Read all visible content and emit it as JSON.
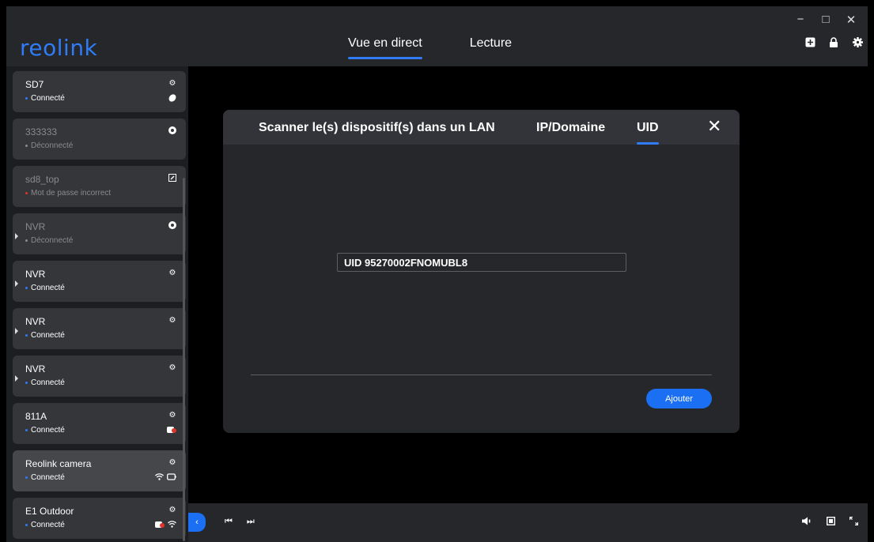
{
  "window": {
    "controls": [
      "−",
      "□",
      "✕"
    ]
  },
  "header": {
    "logo": "reolink",
    "tabs": [
      {
        "label": "Vue en direct",
        "active": true
      },
      {
        "label": "Lecture",
        "active": false
      }
    ],
    "actions": [
      "add-device-icon",
      "lock-icon",
      "gear-icon"
    ]
  },
  "sidebar": {
    "devices": [
      {
        "name": "SD7",
        "status": "Connecté",
        "state": "connected",
        "icon": "gear-icon",
        "extra": "battery-icon"
      },
      {
        "name": "333333",
        "status": "Déconnecté",
        "state": "disconnected",
        "icon": "refresh-icon"
      },
      {
        "name": "sd8_top",
        "status": "Mot de passe incorrect",
        "state": "error",
        "icon": "edit-icon"
      },
      {
        "name": "NVR",
        "status": "Déconnecté",
        "state": "disconnected",
        "icon": "refresh-icon",
        "expandable": true
      },
      {
        "name": "NVR",
        "status": "Connecté",
        "state": "connected",
        "icon": "gear-icon",
        "expandable": true
      },
      {
        "name": "NVR",
        "status": "Connecté",
        "state": "connected",
        "icon": "gear-icon",
        "expandable": true
      },
      {
        "name": "NVR",
        "status": "Connecté",
        "state": "connected",
        "icon": "gear-icon",
        "expandable": true
      },
      {
        "name": "811A",
        "status": "Connecté",
        "state": "connected",
        "icon": "gear-icon",
        "extra": "battery-red-icon"
      },
      {
        "name": "Reolink camera",
        "status": "Connecté",
        "state": "connected",
        "icon": "gear-icon",
        "extra": "wifi-battery-icon",
        "selected": true
      },
      {
        "name": "E1 Outdoor",
        "status": "Connecté",
        "state": "connected",
        "icon": "gear-icon",
        "extra": "record-wifi-icon"
      }
    ]
  },
  "modal": {
    "tabs": [
      {
        "label": "Scanner le(s) dispositif(s) dans un LAN",
        "active": false
      },
      {
        "label": "IP/Domaine",
        "active": false
      },
      {
        "label": "UID",
        "active": true
      }
    ],
    "close": "✕",
    "uid_value": "UID  95270002FNOMUBL8",
    "add_button": "Ajouter"
  },
  "bottom": {
    "collapse": "‹",
    "prev": "⏮",
    "next": "⏭",
    "view_controls": [
      "volume-icon",
      "single-view-icon",
      "fullscreen-icon"
    ]
  },
  "colors": {
    "accent": "#1b6ff2",
    "panel": "#26272b",
    "card": "#35363a",
    "error": "#e0332c"
  }
}
